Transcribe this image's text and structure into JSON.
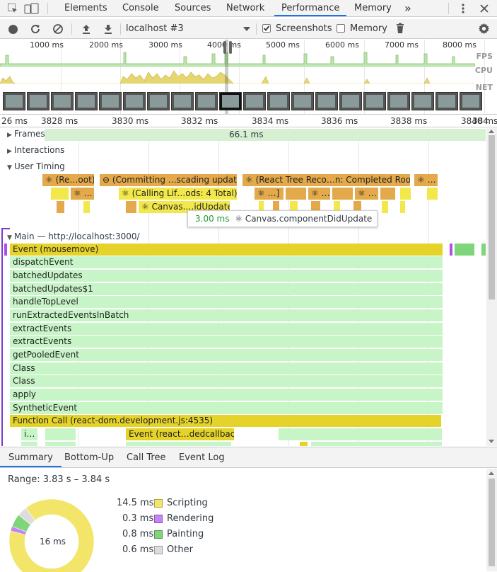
{
  "tabs": [
    "Elements",
    "Console",
    "Sources",
    "Network",
    "Performance",
    "Memory"
  ],
  "active_tab": "Performance",
  "more_tabs": "»",
  "toolbar": {
    "profile_select": "localhost #3",
    "screenshots_label": "Screenshots",
    "screenshots_checked": true,
    "memory_label": "Memory",
    "memory_checked": false
  },
  "overview": {
    "ticks": [
      "1000 ms",
      "2000 ms",
      "3000 ms",
      "4000 ms",
      "5000 ms",
      "6000 ms",
      "7000 ms",
      "8000 ms"
    ],
    "lanes": [
      "FPS",
      "CPU",
      "NET"
    ]
  },
  "ruler": {
    "ticks": [
      "26 ms",
      "3828 ms",
      "3830 ms",
      "3832 ms",
      "3834 ms",
      "3836 ms",
      "3838 ms",
      "3840 ms",
      "384"
    ]
  },
  "tracks": {
    "frames": "Frames",
    "frames_value": "66.1 ms",
    "interactions": "Interactions",
    "user_timing": "User Timing",
    "main": "Main — http://localhost:3000/"
  },
  "user_timing_bars": [
    "⚛ (Re…oot)",
    "⊖ (Committing …scading update",
    "⚛ (React Tree Reco…n: Completed Root)",
    "⚛ …",
    "⚛ …",
    "⚛ (Calling Lif…ods: 4 Total)",
    "⚛ …]",
    "⚛ …",
    "⚛ …",
    "⚛ Canvas.…idUpdate"
  ],
  "tooltip": {
    "time": "3.00 ms",
    "label": "⚛ Canvas.componentDidUpdate"
  },
  "main_stack": [
    "Event (mousemove)",
    "dispatchEvent",
    "batchedUpdates",
    "batchedUpdates$1",
    "handleTopLevel",
    "runExtractedEventsInBatch",
    "extractEvents",
    "extractEvents",
    "getPooledEvent",
    "Class",
    "Class",
    "apply",
    "SyntheticEvent",
    "Function Call (react-dom.development.js:4535)"
  ],
  "main_sub": [
    "i…",
    "Event (react…dedcallback)"
  ],
  "bottom_tabs": [
    "Summary",
    "Bottom-Up",
    "Call Tree",
    "Event Log"
  ],
  "summary": {
    "range": "Range: 3.83 s – 3.84 s",
    "total": "16 ms",
    "items": [
      {
        "value": "14.5 ms",
        "label": "Scripting",
        "color": "#f2e56a",
        "ms": 14.5
      },
      {
        "value": "0.3 ms",
        "label": "Rendering",
        "color": "#c583f5",
        "ms": 0.3
      },
      {
        "value": "0.8 ms",
        "label": "Painting",
        "color": "#7fd67a",
        "ms": 0.8
      },
      {
        "value": "0.6 ms",
        "label": "Other",
        "color": "#dddddd",
        "ms": 0.6
      }
    ]
  }
}
